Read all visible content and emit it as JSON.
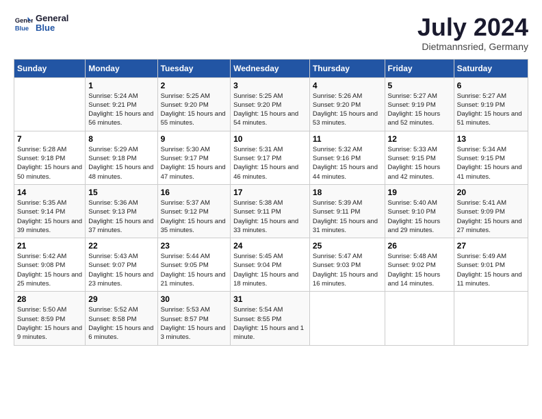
{
  "header": {
    "logo_general": "General",
    "logo_blue": "Blue",
    "month_year": "July 2024",
    "location": "Dietmannsried, Germany"
  },
  "weekdays": [
    "Sunday",
    "Monday",
    "Tuesday",
    "Wednesday",
    "Thursday",
    "Friday",
    "Saturday"
  ],
  "weeks": [
    [
      {
        "day": "",
        "sunrise": "",
        "sunset": "",
        "daylight": ""
      },
      {
        "day": "1",
        "sunrise": "Sunrise: 5:24 AM",
        "sunset": "Sunset: 9:21 PM",
        "daylight": "Daylight: 15 hours and 56 minutes."
      },
      {
        "day": "2",
        "sunrise": "Sunrise: 5:25 AM",
        "sunset": "Sunset: 9:20 PM",
        "daylight": "Daylight: 15 hours and 55 minutes."
      },
      {
        "day": "3",
        "sunrise": "Sunrise: 5:25 AM",
        "sunset": "Sunset: 9:20 PM",
        "daylight": "Daylight: 15 hours and 54 minutes."
      },
      {
        "day": "4",
        "sunrise": "Sunrise: 5:26 AM",
        "sunset": "Sunset: 9:20 PM",
        "daylight": "Daylight: 15 hours and 53 minutes."
      },
      {
        "day": "5",
        "sunrise": "Sunrise: 5:27 AM",
        "sunset": "Sunset: 9:19 PM",
        "daylight": "Daylight: 15 hours and 52 minutes."
      },
      {
        "day": "6",
        "sunrise": "Sunrise: 5:27 AM",
        "sunset": "Sunset: 9:19 PM",
        "daylight": "Daylight: 15 hours and 51 minutes."
      }
    ],
    [
      {
        "day": "7",
        "sunrise": "Sunrise: 5:28 AM",
        "sunset": "Sunset: 9:18 PM",
        "daylight": "Daylight: 15 hours and 50 minutes."
      },
      {
        "day": "8",
        "sunrise": "Sunrise: 5:29 AM",
        "sunset": "Sunset: 9:18 PM",
        "daylight": "Daylight: 15 hours and 48 minutes."
      },
      {
        "day": "9",
        "sunrise": "Sunrise: 5:30 AM",
        "sunset": "Sunset: 9:17 PM",
        "daylight": "Daylight: 15 hours and 47 minutes."
      },
      {
        "day": "10",
        "sunrise": "Sunrise: 5:31 AM",
        "sunset": "Sunset: 9:17 PM",
        "daylight": "Daylight: 15 hours and 46 minutes."
      },
      {
        "day": "11",
        "sunrise": "Sunrise: 5:32 AM",
        "sunset": "Sunset: 9:16 PM",
        "daylight": "Daylight: 15 hours and 44 minutes."
      },
      {
        "day": "12",
        "sunrise": "Sunrise: 5:33 AM",
        "sunset": "Sunset: 9:15 PM",
        "daylight": "Daylight: 15 hours and 42 minutes."
      },
      {
        "day": "13",
        "sunrise": "Sunrise: 5:34 AM",
        "sunset": "Sunset: 9:15 PM",
        "daylight": "Daylight: 15 hours and 41 minutes."
      }
    ],
    [
      {
        "day": "14",
        "sunrise": "Sunrise: 5:35 AM",
        "sunset": "Sunset: 9:14 PM",
        "daylight": "Daylight: 15 hours and 39 minutes."
      },
      {
        "day": "15",
        "sunrise": "Sunrise: 5:36 AM",
        "sunset": "Sunset: 9:13 PM",
        "daylight": "Daylight: 15 hours and 37 minutes."
      },
      {
        "day": "16",
        "sunrise": "Sunrise: 5:37 AM",
        "sunset": "Sunset: 9:12 PM",
        "daylight": "Daylight: 15 hours and 35 minutes."
      },
      {
        "day": "17",
        "sunrise": "Sunrise: 5:38 AM",
        "sunset": "Sunset: 9:11 PM",
        "daylight": "Daylight: 15 hours and 33 minutes."
      },
      {
        "day": "18",
        "sunrise": "Sunrise: 5:39 AM",
        "sunset": "Sunset: 9:11 PM",
        "daylight": "Daylight: 15 hours and 31 minutes."
      },
      {
        "day": "19",
        "sunrise": "Sunrise: 5:40 AM",
        "sunset": "Sunset: 9:10 PM",
        "daylight": "Daylight: 15 hours and 29 minutes."
      },
      {
        "day": "20",
        "sunrise": "Sunrise: 5:41 AM",
        "sunset": "Sunset: 9:09 PM",
        "daylight": "Daylight: 15 hours and 27 minutes."
      }
    ],
    [
      {
        "day": "21",
        "sunrise": "Sunrise: 5:42 AM",
        "sunset": "Sunset: 9:08 PM",
        "daylight": "Daylight: 15 hours and 25 minutes."
      },
      {
        "day": "22",
        "sunrise": "Sunrise: 5:43 AM",
        "sunset": "Sunset: 9:07 PM",
        "daylight": "Daylight: 15 hours and 23 minutes."
      },
      {
        "day": "23",
        "sunrise": "Sunrise: 5:44 AM",
        "sunset": "Sunset: 9:05 PM",
        "daylight": "Daylight: 15 hours and 21 minutes."
      },
      {
        "day": "24",
        "sunrise": "Sunrise: 5:45 AM",
        "sunset": "Sunset: 9:04 PM",
        "daylight": "Daylight: 15 hours and 18 minutes."
      },
      {
        "day": "25",
        "sunrise": "Sunrise: 5:47 AM",
        "sunset": "Sunset: 9:03 PM",
        "daylight": "Daylight: 15 hours and 16 minutes."
      },
      {
        "day": "26",
        "sunrise": "Sunrise: 5:48 AM",
        "sunset": "Sunset: 9:02 PM",
        "daylight": "Daylight: 15 hours and 14 minutes."
      },
      {
        "day": "27",
        "sunrise": "Sunrise: 5:49 AM",
        "sunset": "Sunset: 9:01 PM",
        "daylight": "Daylight: 15 hours and 11 minutes."
      }
    ],
    [
      {
        "day": "28",
        "sunrise": "Sunrise: 5:50 AM",
        "sunset": "Sunset: 8:59 PM",
        "daylight": "Daylight: 15 hours and 9 minutes."
      },
      {
        "day": "29",
        "sunrise": "Sunrise: 5:52 AM",
        "sunset": "Sunset: 8:58 PM",
        "daylight": "Daylight: 15 hours and 6 minutes."
      },
      {
        "day": "30",
        "sunrise": "Sunrise: 5:53 AM",
        "sunset": "Sunset: 8:57 PM",
        "daylight": "Daylight: 15 hours and 3 minutes."
      },
      {
        "day": "31",
        "sunrise": "Sunrise: 5:54 AM",
        "sunset": "Sunset: 8:55 PM",
        "daylight": "Daylight: 15 hours and 1 minute."
      },
      {
        "day": "",
        "sunrise": "",
        "sunset": "",
        "daylight": ""
      },
      {
        "day": "",
        "sunrise": "",
        "sunset": "",
        "daylight": ""
      },
      {
        "day": "",
        "sunrise": "",
        "sunset": "",
        "daylight": ""
      }
    ]
  ]
}
